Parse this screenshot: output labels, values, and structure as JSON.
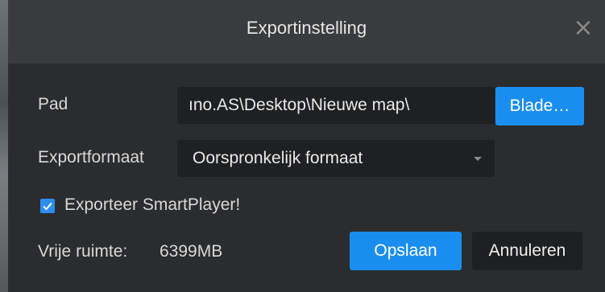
{
  "dialog": {
    "title": "Exportinstelling",
    "close_icon": "close-icon"
  },
  "path": {
    "label": "Pad",
    "value": "ıno.AS\\Desktop\\Nieuwe map\\",
    "browse_label": "Blade…"
  },
  "format": {
    "label": "Exportformaat",
    "selected": "Oorspronkelijk formaat",
    "caret_icon": "chevron-down-icon"
  },
  "smartplayer": {
    "checked": true,
    "label": "Exporteer SmartPlayer!"
  },
  "space": {
    "label": "Vrije ruimte:",
    "value": "6399MB"
  },
  "actions": {
    "save_label": "Opslaan",
    "cancel_label": "Annuleren"
  },
  "colors": {
    "accent": "#1a8ef0",
    "dialog_bg": "#2b2c2e",
    "titlebar_bg": "#3a3b3d",
    "field_bg": "#1f2022"
  }
}
